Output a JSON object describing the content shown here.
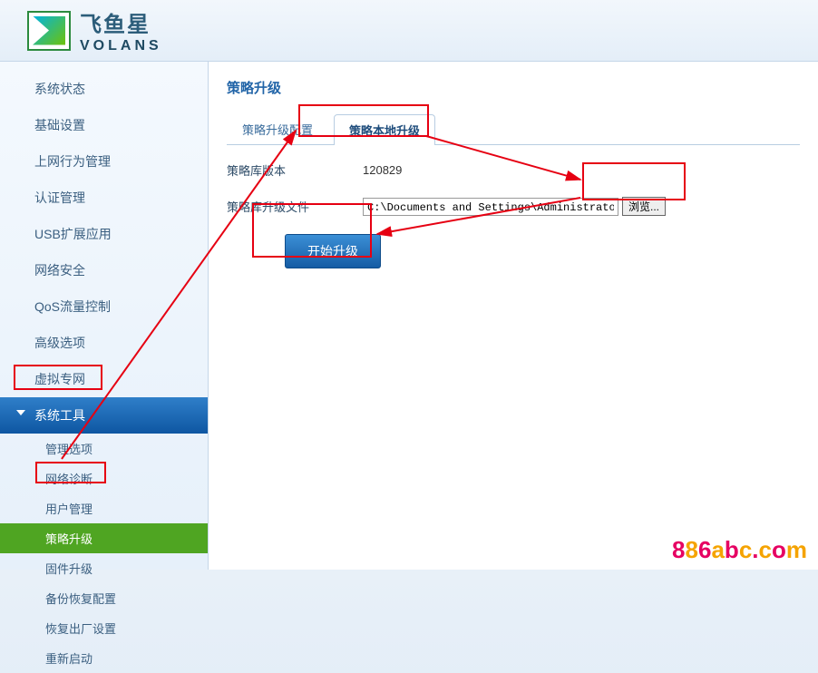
{
  "brand": {
    "cn": "飞鱼星",
    "en": "VOLANS"
  },
  "sidebar": {
    "items": [
      {
        "label": "系统状态"
      },
      {
        "label": "基础设置"
      },
      {
        "label": "上网行为管理"
      },
      {
        "label": "认证管理"
      },
      {
        "label": "USB扩展应用"
      },
      {
        "label": "网络安全"
      },
      {
        "label": "QoS流量控制"
      },
      {
        "label": "高级选项"
      },
      {
        "label": "虚拟专网"
      },
      {
        "label": "系统工具"
      }
    ],
    "sub": [
      {
        "label": "管理选项"
      },
      {
        "label": "网络诊断"
      },
      {
        "label": "用户管理"
      },
      {
        "label": "策略升级"
      },
      {
        "label": "固件升级"
      },
      {
        "label": "备份恢复配置"
      },
      {
        "label": "恢复出厂设置"
      },
      {
        "label": "重新启动"
      }
    ]
  },
  "main": {
    "title": "策略升级",
    "tabs": [
      {
        "label": "策略升级配置"
      },
      {
        "label": "策略本地升级"
      }
    ],
    "version_label": "策略库版本",
    "version_value": "120829",
    "file_label": "策略库升级文件",
    "file_value": "C:\\Documents and Settings\\Administrator\\桌面",
    "browse_label": "浏览...",
    "start_label": "开始升级"
  },
  "watermark": "886abc.com"
}
